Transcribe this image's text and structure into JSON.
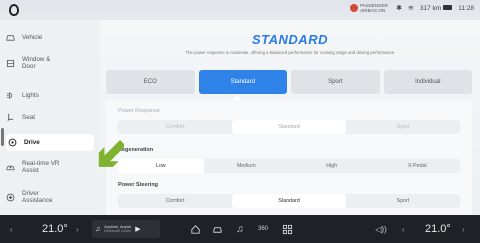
{
  "status": {
    "airbag": "PASSENGER AIRBAG ON",
    "range": "317 km",
    "time": "11:28",
    "bluetooth_icon": "bluetooth-icon",
    "wifi_icon": "wifi-icon",
    "battery_icon": "battery-icon"
  },
  "sidebar": {
    "items": [
      {
        "label": "Vehicle",
        "icon": "car-icon"
      },
      {
        "label": "Window & Door",
        "icon": "window-icon"
      },
      {
        "label": "Lights",
        "icon": "light-icon"
      },
      {
        "label": "Seat",
        "icon": "seat-icon"
      },
      {
        "label": "Drive",
        "icon": "steering-icon"
      },
      {
        "label": "Real-time VR Assist",
        "icon": "vr-icon"
      },
      {
        "label": "Driver Assistance",
        "icon": "assist-icon"
      }
    ],
    "active": "Drive"
  },
  "main": {
    "title": "STANDARD",
    "description": "The power response is moderate, offering a balanced performance for cruising range and driving performance",
    "modes": [
      "ECO",
      "Standard",
      "Sport",
      "Individual"
    ],
    "selected_mode": "Standard"
  },
  "power_response": {
    "label": "Power Response",
    "options": [
      "Comfort",
      "Standard",
      "Sport"
    ],
    "selected": "Standard"
  },
  "regeneration": {
    "label": "Regeneration",
    "options": [
      "Low",
      "Medium",
      "High",
      "X-Pedal"
    ],
    "selected": "Low"
  },
  "power_steering": {
    "label": "Power Steering",
    "options": [
      "Comfort",
      "Standard",
      "Sport"
    ],
    "selected": "Standard"
  },
  "dock": {
    "left_temp": "21.0°",
    "right_temp": "21.0°",
    "music_title": "Anytime, Anywh",
    "music_source": "Bluetooth Audio"
  },
  "colors": {
    "accent": "#2f83e8",
    "pointer_arrow": "#7fb22e"
  }
}
